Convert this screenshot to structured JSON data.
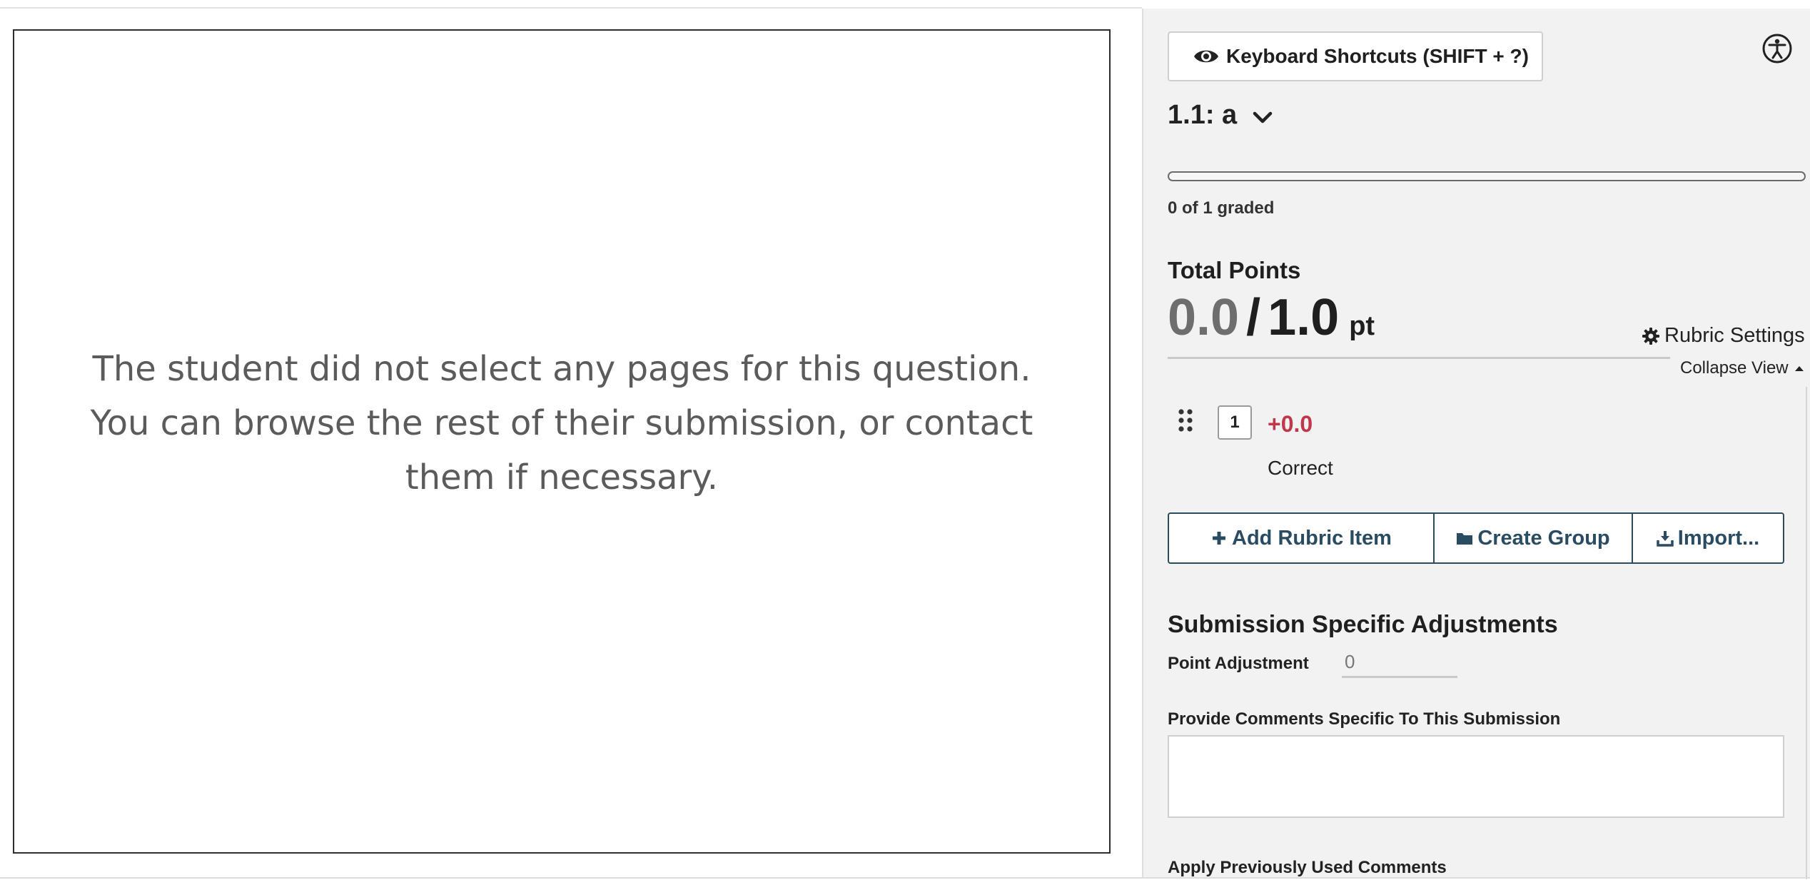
{
  "viewer": {
    "message_line1": "The student did not select any pages for this question.",
    "message_line2": "You can browse the rest of their submission, or contact",
    "message_line3": "them if necessary."
  },
  "panel": {
    "keyboard_shortcuts_label": "Keyboard Shortcuts (SHIFT + ?)",
    "question_label": "1.1: a",
    "graded_status": "0 of 1 graded",
    "graded_fraction": 0.0,
    "total_points_label": "Total Points",
    "score_current": "0.0",
    "score_separator": "/",
    "score_max": "1.0",
    "score_unit": "pt",
    "rubric_settings_label": "Rubric Settings",
    "collapse_view_label": "Collapse View",
    "rubric_items": [
      {
        "key": "1",
        "points": "+0.0",
        "description": "Correct"
      }
    ],
    "buttons": {
      "add_rubric_item": "Add Rubric Item",
      "create_group": "Create Group",
      "import": "Import..."
    },
    "adjustments": {
      "title": "Submission Specific Adjustments",
      "point_adjustment_label": "Point Adjustment",
      "point_adjustment_value": "0",
      "comments_label": "Provide Comments Specific To This Submission",
      "comments_value": "",
      "apply_previous_label": "Apply Previously Used Comments"
    }
  },
  "colors": {
    "accent": "#2a4c62",
    "points_negative": "#c0364a",
    "panel_bg": "#f2f2f2"
  },
  "icons": [
    "eye-icon",
    "accessibility-icon",
    "chevron-down-icon",
    "gear-icon",
    "caret-up-icon",
    "drag-handle-icon",
    "plus-icon",
    "folder-icon",
    "download-icon"
  ]
}
